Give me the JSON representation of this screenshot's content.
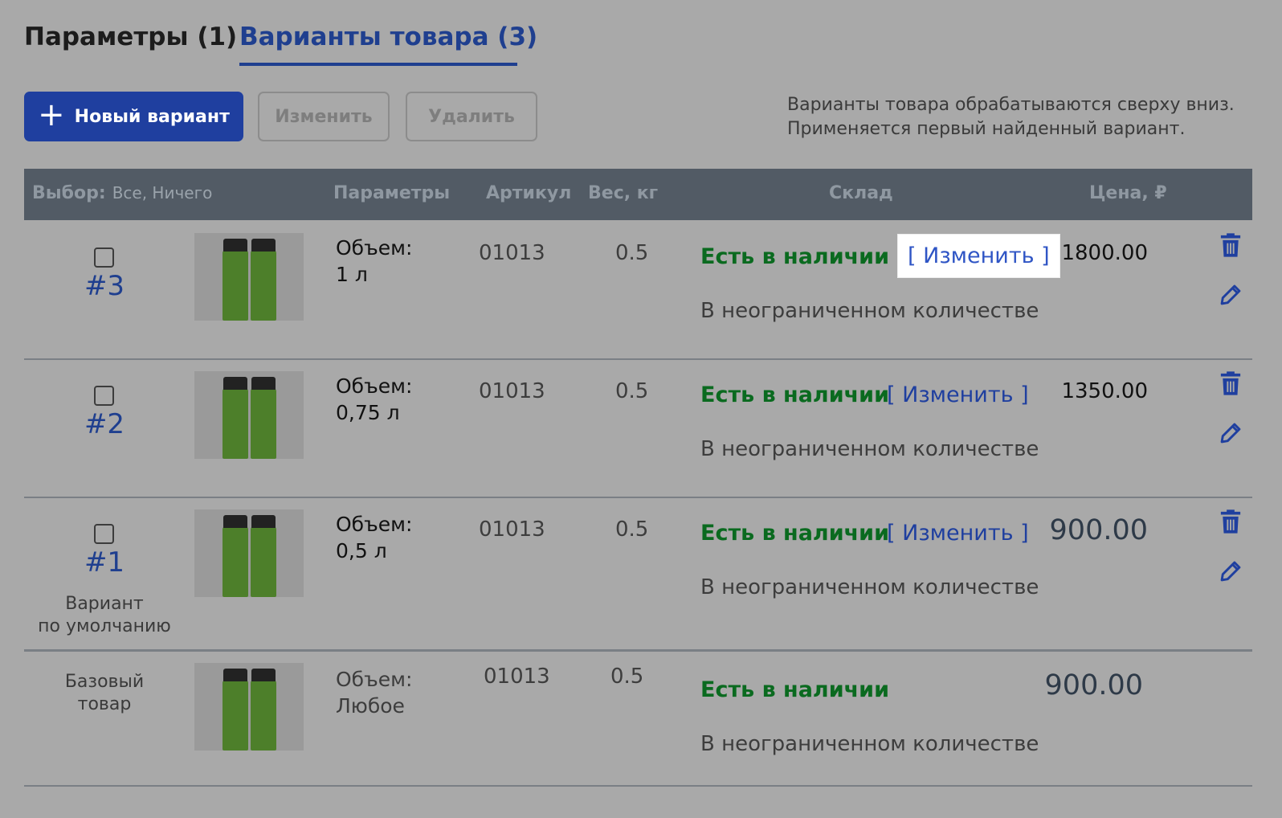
{
  "tabs": [
    {
      "label": "Параметры (1)",
      "active": false
    },
    {
      "label": "Варианты товара (3)",
      "active": true
    }
  ],
  "toolbar": {
    "new_label": "Новый вариант",
    "edit_label": "Изменить",
    "delete_label": "Удалить"
  },
  "hint": {
    "line1": "Варианты товара обрабатываются сверху вниз.",
    "line2": "Применяется первый найденный вариант."
  },
  "table": {
    "headers": {
      "select": "Выбор:",
      "select_links": "Все, Ничего",
      "params": "Параметры",
      "sku": "Артикул",
      "weight": "Вес, кг",
      "stock": "Склад",
      "price": "Цена, ₽"
    },
    "rows": [
      {
        "number": "#3",
        "param_name": "Объем:",
        "param_value": "1 л",
        "sku": "01013",
        "weight": "0.5",
        "stock": "Есть в наличии",
        "change": "[ Изменить ]",
        "quantity": "В неограниченном количестве",
        "price": "1800.00"
      },
      {
        "number": "#2",
        "param_name": "Объем:",
        "param_value": "0,75 л",
        "sku": "01013",
        "weight": "0.5",
        "stock": "Есть в наличии",
        "change": "[ Изменить ]",
        "quantity": "В неограниченном количестве",
        "price": "1350.00"
      },
      {
        "number": "#1",
        "default_label_1": "Вариант",
        "default_label_2": "по умолчанию",
        "param_name": "Объем:",
        "param_value": "0,5 л",
        "sku": "01013",
        "weight": "0.5",
        "stock": "Есть в наличии",
        "change": "[ Изменить ]",
        "quantity": "В неограниченном количестве",
        "price": "900.00"
      }
    ],
    "base": {
      "label_1": "Базовый",
      "label_2": "товар",
      "param_name": "Объем:",
      "param_value": "Любое",
      "sku": "01013",
      "weight": "0.5",
      "stock": "Есть в наличии",
      "quantity": "В неограниченном количестве",
      "price": "900.00"
    }
  },
  "icons": {
    "trash": "trash-icon",
    "edit": "pencil-icon",
    "plus": "plus-icon"
  },
  "colors": {
    "accent": "#1f3f9f",
    "in_stock": "#0a6a1f",
    "header_bg": "#525b65"
  }
}
